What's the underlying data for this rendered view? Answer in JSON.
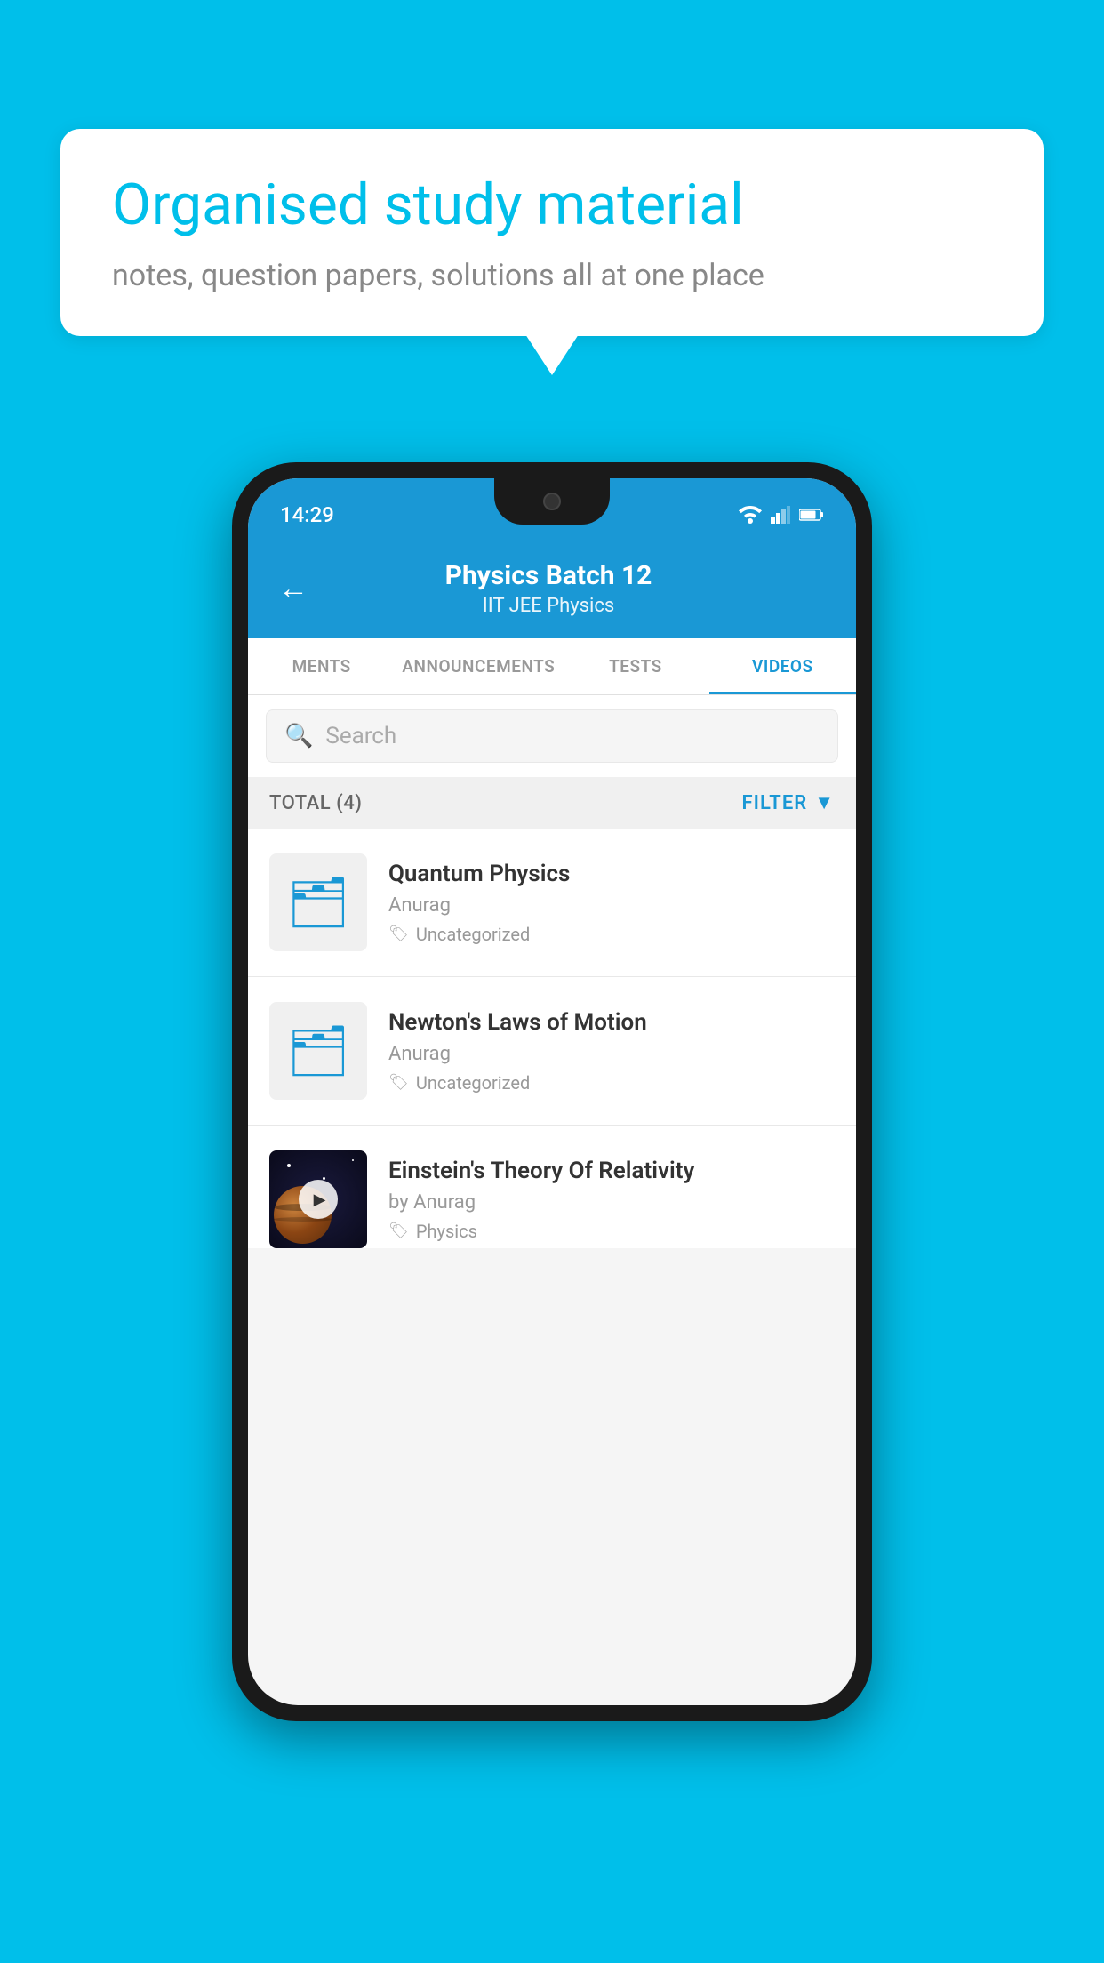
{
  "background_color": "#00BFEA",
  "speech_bubble": {
    "title": "Organised study material",
    "subtitle": "notes, question papers, solutions all at one place"
  },
  "phone": {
    "status_bar": {
      "time": "14:29"
    },
    "header": {
      "back_label": "←",
      "title": "Physics Batch 12",
      "subtitle": "IIT JEE   Physics"
    },
    "tabs": [
      {
        "label": "MENTS",
        "active": false
      },
      {
        "label": "ANNOUNCEMENTS",
        "active": false
      },
      {
        "label": "TESTS",
        "active": false
      },
      {
        "label": "VIDEOS",
        "active": true
      }
    ],
    "search": {
      "placeholder": "Search"
    },
    "filter": {
      "total_label": "TOTAL (4)",
      "filter_label": "FILTER"
    },
    "videos": [
      {
        "title": "Quantum Physics",
        "author": "Anurag",
        "tag": "Uncategorized",
        "has_thumbnail": false
      },
      {
        "title": "Newton's Laws of Motion",
        "author": "Anurag",
        "tag": "Uncategorized",
        "has_thumbnail": false
      },
      {
        "title": "Einstein's Theory Of Relativity",
        "author": "by Anurag",
        "tag": "Physics",
        "has_thumbnail": true
      }
    ]
  }
}
